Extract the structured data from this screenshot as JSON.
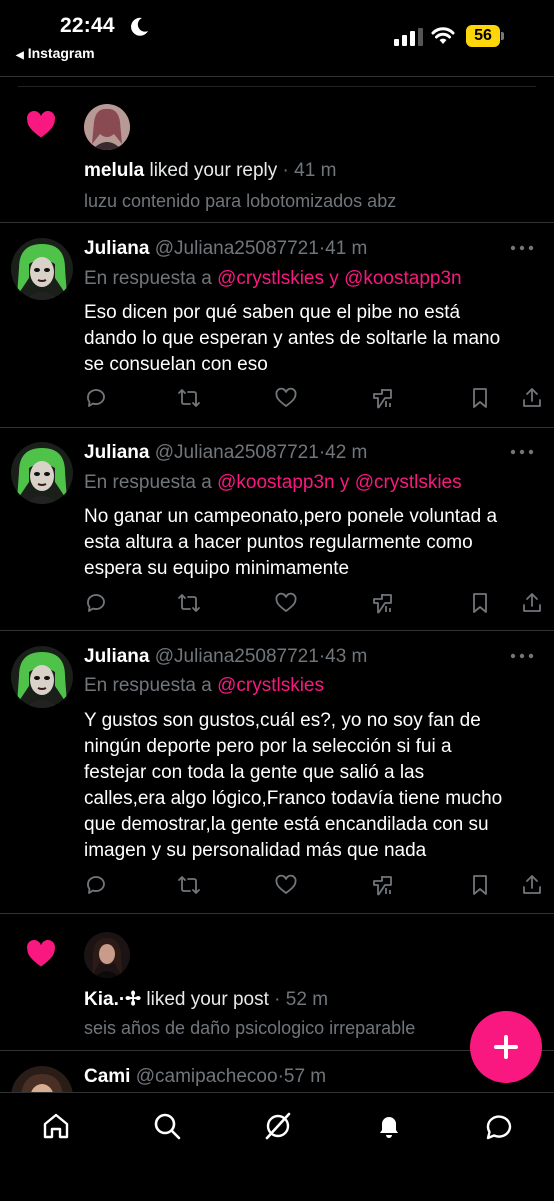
{
  "status_bar": {
    "time": "22:44",
    "back_app": "Instagram",
    "battery": "56"
  },
  "colors": {
    "accent_pink": "#f91880",
    "muted": "#71767b",
    "battery_yellow": "#ffd60a"
  },
  "notifications": [
    {
      "type": "like",
      "user": "melula",
      "action": "liked your reply",
      "separator": "·",
      "time": "41 m",
      "snippet": "luzu contenido para lobotomizados abz"
    }
  ],
  "tweets": [
    {
      "name": "Juliana",
      "handle": "@Juliana25087721",
      "separator": "·",
      "time": "41 m",
      "reply_prefix": "En respuesta a",
      "reply_to_1": "@crystlskies",
      "reply_and": "y",
      "reply_to_2": "@koostapp3n",
      "lines": [
        "Eso dicen por qué saben que el pibe no está",
        "dando lo que esperan y antes de soltarle la mano",
        "se consuelan con eso"
      ]
    },
    {
      "name": "Juliana",
      "handle": "@Juliana25087721",
      "separator": "·",
      "time": "42 m",
      "reply_prefix": "En respuesta a",
      "reply_to_1": "@koostapp3n",
      "reply_and": "y",
      "reply_to_2": "@crystlskies",
      "lines": [
        "No ganar un campeonato,pero ponele voluntad a",
        "esta altura a hacer puntos regularmente como",
        "espera su equipo minimamente"
      ]
    },
    {
      "name": "Juliana",
      "handle": "@Juliana25087721",
      "separator": "·",
      "time": "43 m",
      "reply_prefix": "En respuesta a",
      "reply_to_1": "@crystlskies",
      "lines": [
        "Y gustos son gustos,cuál es?,  yo no soy fan de",
        "ningún deporte pero por la selección si fui a",
        "festejar con toda la gente que salió a las",
        "calles,era algo lógico,Franco todavía tiene mucho",
        "que demostrar,la gente está encandilada con su",
        "imagen y su personalidad más que nada"
      ]
    }
  ],
  "notification_2": {
    "user": "Kia.·✢",
    "action": "liked your post",
    "separator": "·",
    "time": "52 m",
    "snippet": "seis años de daño psicologico irreparable"
  },
  "partial_tweet": {
    "name": "Cami",
    "handle": "@camipachecoo",
    "separator": "·",
    "time": "57 m"
  },
  "action_icons": [
    "reply-icon",
    "retweet-icon",
    "like-icon",
    "views-icon",
    "bookmark-icon",
    "share-icon"
  ],
  "bottom_nav": [
    "home-icon",
    "search-icon",
    "grok-icon",
    "notifications-icon",
    "messages-icon"
  ]
}
